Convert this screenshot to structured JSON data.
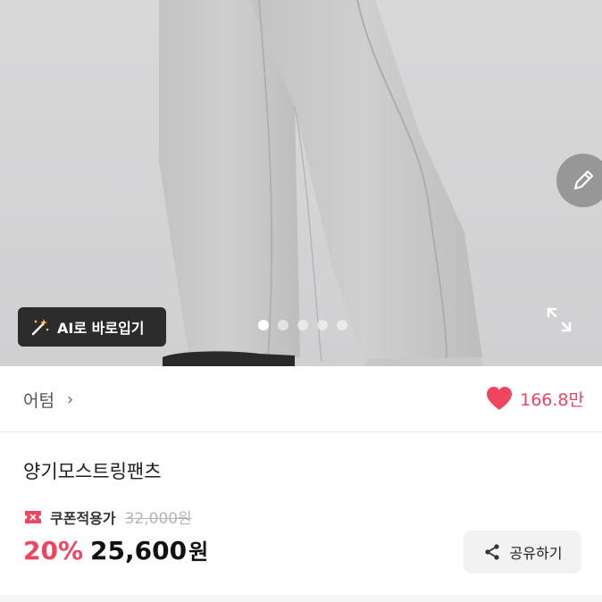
{
  "hero": {
    "ai_button_label": "AI로 바로입기",
    "carousel": {
      "total": 5,
      "active_index": 0
    },
    "icons": {
      "wand": "magic-wand-icon",
      "expand": "expand-icon",
      "edit": "pencil-icon"
    }
  },
  "brand": {
    "name": "어텀",
    "chevron": "›",
    "like_count": "166.8만"
  },
  "product": {
    "name": "양기모스트링팬츠",
    "coupon_label": "쿠폰적용가",
    "original_price": "32,000원",
    "discount": "20%",
    "price": "25,600",
    "currency": "원"
  },
  "share": {
    "label": "공유하기"
  },
  "colors": {
    "accent": "#f0455f",
    "share_bg": "#f2f2f3"
  }
}
